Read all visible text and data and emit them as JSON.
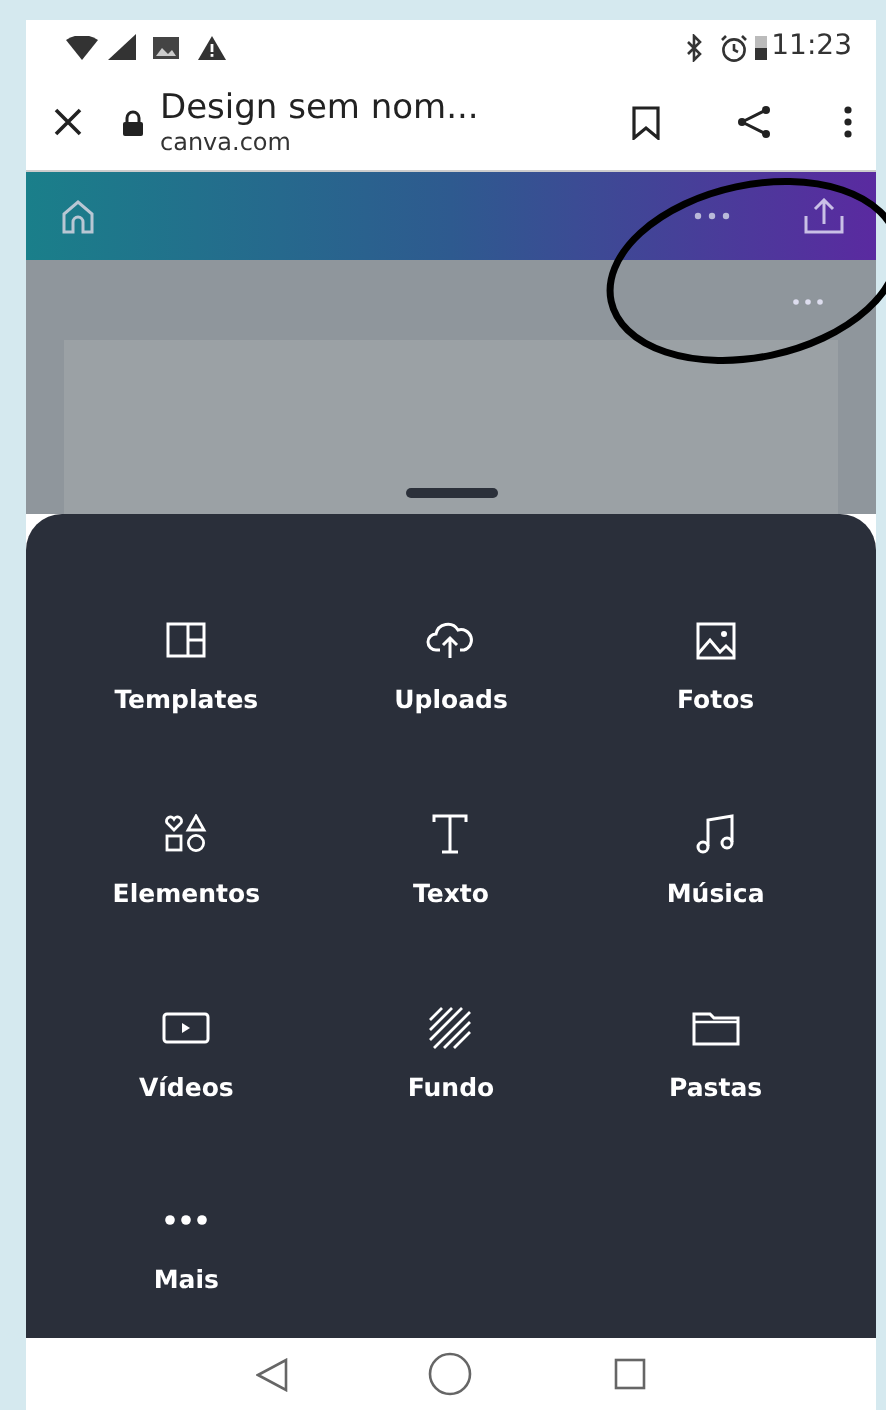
{
  "status_bar": {
    "time": "11:23"
  },
  "browser_bar": {
    "title": "Design sem nom...",
    "url": "canva.com"
  },
  "menu_items": [
    {
      "kind": "templates",
      "label": "Templates"
    },
    {
      "kind": "uploads",
      "label": "Uploads"
    },
    {
      "kind": "photos",
      "label": "Fotos"
    },
    {
      "kind": "elements",
      "label": "Elementos"
    },
    {
      "kind": "text",
      "label": "Texto"
    },
    {
      "kind": "music",
      "label": "Música"
    },
    {
      "kind": "videos",
      "label": "Vídeos"
    },
    {
      "kind": "background",
      "label": "Fundo"
    },
    {
      "kind": "folders",
      "label": "Pastas"
    },
    {
      "kind": "more",
      "label": "Mais"
    }
  ]
}
